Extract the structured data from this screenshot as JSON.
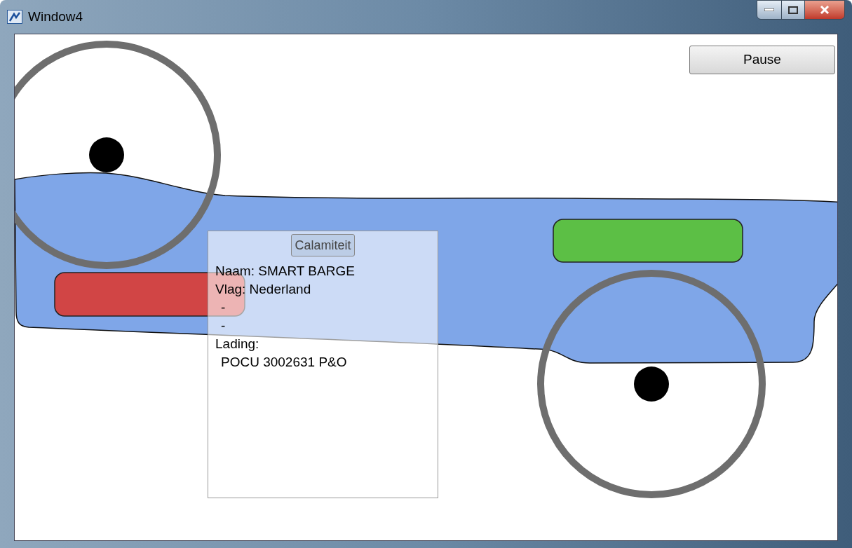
{
  "window": {
    "title": "Window4"
  },
  "pause_button": {
    "label": "Pause"
  },
  "info_panel": {
    "button": "Calamiteit",
    "lines": [
      {
        "text": "Naam: SMART BARGE",
        "indented": false
      },
      {
        "text": "Vlag: Nederland",
        "indented": false
      },
      {
        "text": "-",
        "indented": true
      },
      {
        "text": "-",
        "indented": true
      },
      {
        "text": "Lading:",
        "indented": false
      },
      {
        "text": "POCU 3002631 P&O",
        "indented": true
      }
    ]
  }
}
